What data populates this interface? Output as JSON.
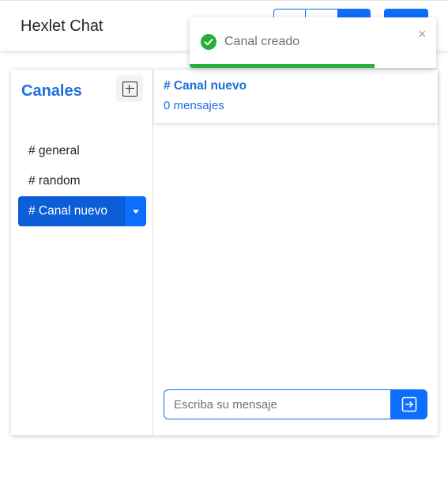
{
  "navbar": {
    "brand": "Hexlet Chat"
  },
  "sidebar": {
    "title": "Canales",
    "add_channel_icon": "plus-square-icon",
    "channels": [
      {
        "label": "# general",
        "active": false
      },
      {
        "label": "# random",
        "active": false
      },
      {
        "label": "# Canal nuevo",
        "active": true
      }
    ],
    "dropdown_icon": "caret-down-icon"
  },
  "chat": {
    "channel_title": "# Canal nuevo",
    "message_count": "0 mensajes",
    "input": {
      "value": "",
      "placeholder": "Escriba su mensaje"
    },
    "send_icon": "arrow-right-square-icon"
  },
  "toast": {
    "text": "Canal creado",
    "icon": "check-circle-icon",
    "close_glyph": "×",
    "progress": 0.75,
    "progress_color": "#27ae3c"
  },
  "colors": {
    "primary": "#0d6efd",
    "active_channel": "#0b5ed7",
    "link_blue": "#1f6fdb",
    "success": "#27ae3c"
  }
}
